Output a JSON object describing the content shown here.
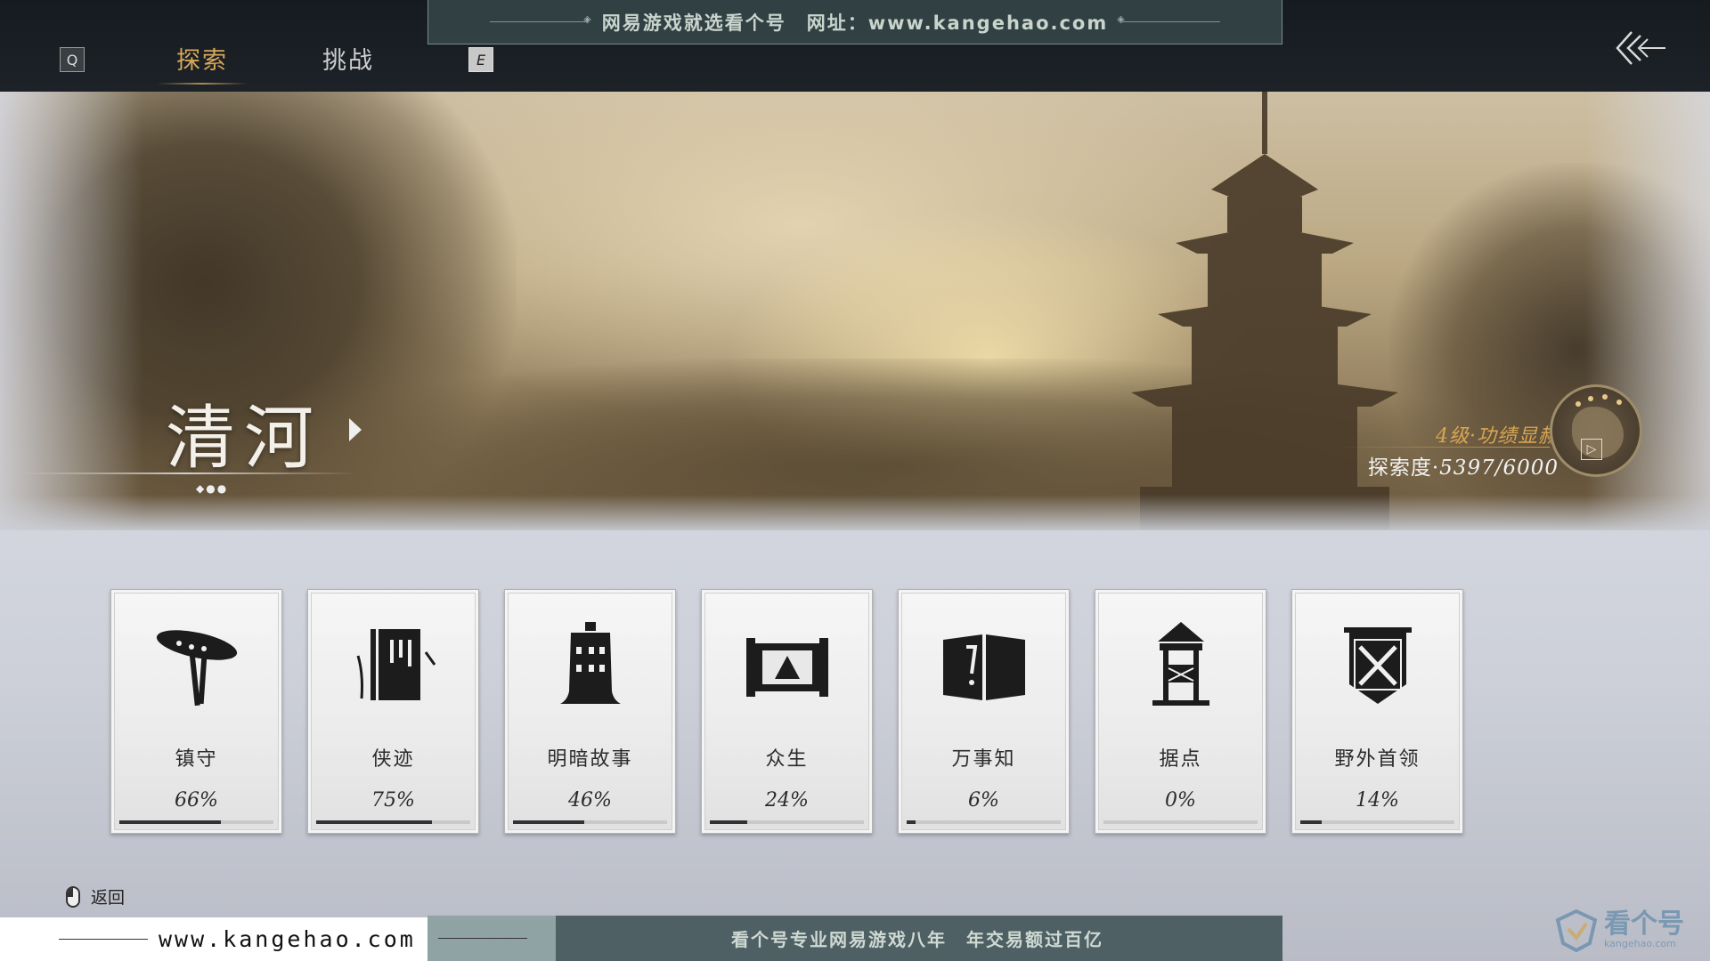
{
  "topbar": {
    "key_left": "Q",
    "key_right": "E",
    "tabs": [
      {
        "label": "探索",
        "active": true
      },
      {
        "label": "挑战",
        "active": false
      }
    ],
    "watermark": "网易游戏就选看个号　网址：www.kangehao.com"
  },
  "banner": {
    "region_name": "清河",
    "region_dots": "◆●●",
    "level": "4级·功绩显赫",
    "explore_label": "探索度·",
    "explore_progress": "5397/6000",
    "explore_current": 5397,
    "explore_total": 6000
  },
  "categories": [
    {
      "label": "镇守",
      "percent": "66%",
      "value": 66,
      "icon": "bamboo-hat-icon"
    },
    {
      "label": "侠迹",
      "percent": "75%",
      "value": 75,
      "icon": "book-icon"
    },
    {
      "label": "明暗故事",
      "percent": "46%",
      "value": 46,
      "icon": "bell-icon"
    },
    {
      "label": "众生",
      "percent": "24%",
      "value": 24,
      "icon": "scroll-painting-icon"
    },
    {
      "label": "万事知",
      "percent": "6%",
      "value": 6,
      "icon": "open-book-icon"
    },
    {
      "label": "据点",
      "percent": "0%",
      "value": 0,
      "icon": "watchtower-icon"
    },
    {
      "label": "野外首领",
      "percent": "14%",
      "value": 14,
      "icon": "crossed-swords-banner-icon"
    }
  ],
  "bottom": {
    "return_label": "返回",
    "footer_url": "www.kangehao.com",
    "watermark": "看个号专业网易游戏八年　年交易额过百亿",
    "corner_logo": "看个号",
    "corner_logo_sub": "kangehao.com"
  },
  "colors": {
    "accent_gold": "#d8a85a",
    "topbar_bg": "#161b20",
    "progress_fill": "#2f3236"
  }
}
